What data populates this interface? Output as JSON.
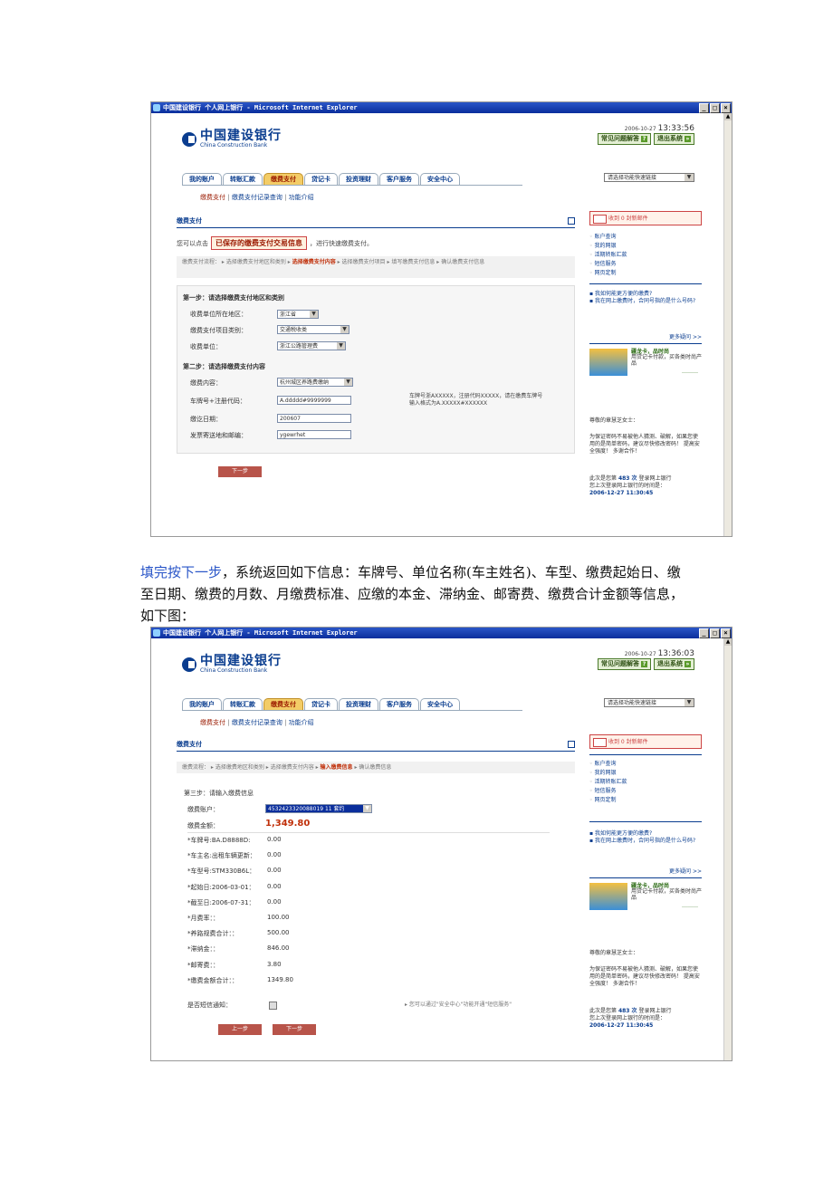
{
  "window": {
    "title": "中国建设银行 个人网上银行 - Microsoft Internet Explorer",
    "buttons": [
      "_",
      "□",
      "×"
    ]
  },
  "header": {
    "logo_cn": "中国建设银行",
    "logo_en": "China Construction Bank",
    "faq_button": "常见问题解答",
    "exit_button": "退出系统",
    "quick_link_placeholder": "请选择功能快速链接"
  },
  "tabs": [
    "我的账户",
    "转账汇款",
    "缴费支付",
    "贷记卡",
    "投资理财",
    "客户服务",
    "安全中心"
  ],
  "subnav": {
    "payment": "缴费支付",
    "records": "缴费支付记录查询",
    "intro": "功能介绍",
    "sep": "|"
  },
  "section_title": "缴费支付",
  "sidebar": {
    "mail_text": "收到 0 封新邮件",
    "links": [
      "账户查询",
      "我的网银",
      "活期转账汇款",
      "短信服务",
      "网页定制"
    ],
    "faq": [
      "我如何能更方便的缴费?",
      "我在网上缴费时，合同号指的是什么号码?"
    ],
    "more": "更多疑问 >>",
    "promo_title": "疆龙卡，品时尚",
    "promo_text": "用贷记卡付款，买各类时尚产品",
    "promo_go": "………",
    "greeting": "尊敬的章慧芝女士：",
    "security_tip": "为保证密码不易被他人猜测、破解，如果您使用的是简单密码，建议尽快修改密码！ 提高安全强度！ 多谢合作！",
    "login_line1": "此次是您第",
    "login_count": "483 次",
    "login_line2": "登录网上银行",
    "last_login_label": "您上次登录网上银行的时间是：",
    "last_login_time": "2006-12-27 11:30:45"
  },
  "shot1": {
    "date": "2006-10-27",
    "time": "13:33:56",
    "saved_prefix": "您可以点击",
    "saved_button": "已保存的缴费支付交易信息",
    "saved_suffix": "，进行快速缴费支付。",
    "flow_label": "缴费支付流程：",
    "flow_steps": [
      "选择缴费支付地区和类别",
      "选择缴费支付内容",
      "选择缴费支付项目",
      "填写缴费支付信息",
      "确认缴费支付信息"
    ],
    "step1_title": "第一步：请选择缴费支付地区和类别",
    "region_label": "收费单位所在地区：",
    "region_value": "浙江省",
    "category_label": "缴费支付项目类别：",
    "category_value": "交通税收类",
    "unit_label": "收费单位：",
    "unit_value": "浙江公路管理费",
    "step2_title": "第二步：请选择缴费支付内容",
    "content_label": "缴费内容：",
    "content_value": "杭州城区养路费缴纳",
    "plate_label": "车牌号+注册代码：",
    "plate_value": "A.ddddd#9999999",
    "plate_hint1": "车牌号浙AXXXXX，注册代码XXXXX，请在缴费车牌号",
    "plate_hint2": "输入格式为A.XXXXX#XXXXXX",
    "deadline_label": "缴讫日期：",
    "deadline_value": "200607",
    "invoice_label": "发票寄送地和邮编：",
    "invoice_value": "ygewrhet",
    "next_button": "下一步"
  },
  "prose": {
    "link_text": "填完按下一步",
    "text": "，系统返回如下信息：车牌号、单位名称(车主姓名)、车型、缴费起始日、缴至日期、缴费的月数、月缴费标准、应缴的本金、滞纳金、邮寄费、缴费合计金额等信息，如下图："
  },
  "shot2": {
    "date": "2006-10-27",
    "time": "13:36:03",
    "flow_label": "缴费流程：",
    "flow_steps": [
      "选择缴费地区和类别",
      "选择缴费支付内容",
      "输入缴费信息",
      "确认缴费信息"
    ],
    "step3_title": "第三步：请输入缴费信息",
    "account_label": "缴费账户：",
    "account_value": "4532423320088019 11 套约",
    "amount_label": "缴费金额：",
    "amount_value": "1,349.80",
    "rows": [
      {
        "label": "车牌号:BA.D8888D:",
        "value": "0.00"
      },
      {
        "label": "车主名:出租车辆更新：",
        "value": "0.00"
      },
      {
        "label": "车型号:STM330B6L：",
        "value": "0.00"
      },
      {
        "label": "起始日:2006-03-01：",
        "value": "0.00"
      },
      {
        "label": "截至日:2006-07-31：",
        "value": "0.00"
      },
      {
        "label": "月费率：：",
        "value": "100.00"
      },
      {
        "label": "养路规费合计：：",
        "value": "500.00"
      },
      {
        "label": "滞纳金：：",
        "value": "846.00"
      },
      {
        "label": "邮寄费：：",
        "value": "3.80"
      },
      {
        "label": "缴费金额合计：：",
        "value": "1349.80"
      }
    ],
    "sms_label": "是否短信通知：",
    "sms_hint": "▸ 您可以通过\"安全中心\"功能开通\"短信服务\"",
    "prev_button": "上一步",
    "next_button": "下一步"
  }
}
